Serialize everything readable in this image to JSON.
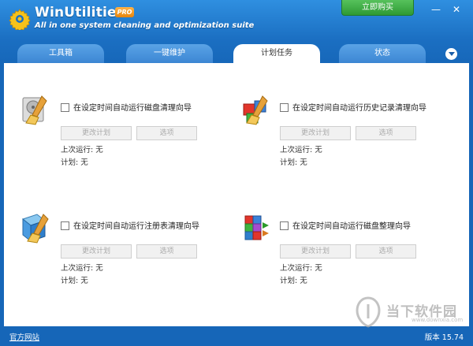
{
  "header": {
    "app_title": "WinUtilities",
    "badge": "PRO",
    "subtitle": "All in one system cleaning and optimization suite",
    "buy_label": "立即购买",
    "minimize_glyph": "—",
    "close_glyph": "✕"
  },
  "tabs": [
    {
      "label": "工具箱",
      "active": false
    },
    {
      "label": "一键维护",
      "active": false
    },
    {
      "label": "计划任务",
      "active": true
    },
    {
      "label": "状态",
      "active": false
    }
  ],
  "tasks": [
    {
      "icon": "disk-cleaner-icon",
      "label": "在设定时间自动运行磁盘清理向导",
      "checked": false,
      "change_label": "更改计划",
      "options_label": "选项",
      "last_run": "上次运行: 无",
      "plan": "计划: 无"
    },
    {
      "icon": "history-cleaner-icon",
      "label": "在设定时间自动运行历史记录清理向导",
      "checked": false,
      "change_label": "更改计划",
      "options_label": "选项",
      "last_run": "上次运行: 无",
      "plan": "计划: 无"
    },
    {
      "icon": "registry-cleaner-icon",
      "label": "在设定时间自动运行注册表清理向导",
      "checked": false,
      "change_label": "更改计划",
      "options_label": "选项",
      "last_run": "上次运行: 无",
      "plan": "计划: 无"
    },
    {
      "icon": "disk-defrag-icon",
      "label": "在设定时间自动运行磁盘整理向导",
      "checked": false,
      "change_label": "更改计划",
      "options_label": "选项",
      "last_run": "上次运行: 无",
      "plan": "计划: 无"
    }
  ],
  "watermark": {
    "text": "当下软件园",
    "url": "www.downxia.com"
  },
  "footer": {
    "website_link": "官方网站",
    "version": "版本 15.74"
  },
  "colors": {
    "accent_blue": "#1b6fc2",
    "buy_green": "#3aa83f",
    "pro_orange": "#f39a21"
  }
}
